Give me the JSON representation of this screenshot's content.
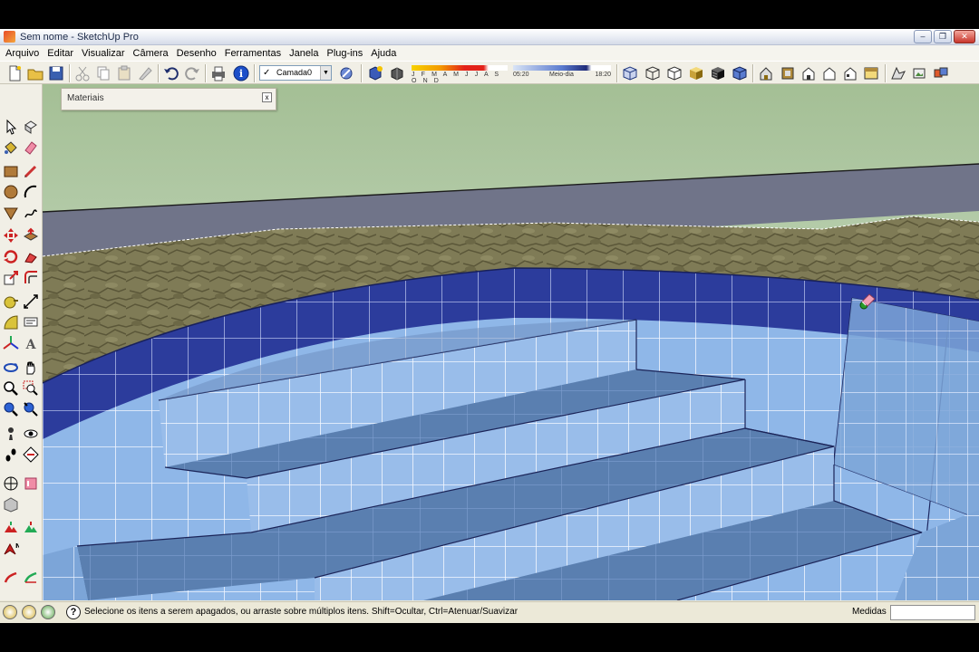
{
  "window": {
    "title": "Sem nome - SketchUp Pro",
    "minimize_glyph": "–",
    "maximize_glyph": "❐",
    "close_glyph": "✕"
  },
  "menu": [
    "Arquivo",
    "Editar",
    "Visualizar",
    "Câmera",
    "Desenho",
    "Ferramentas",
    "Janela",
    "Plug-ins",
    "Ajuda"
  ],
  "toolbar": {
    "layer_check": "✓",
    "layer_name": "Camada0",
    "layer_arrow": "▼",
    "shadow_months": "J F M A M J J A S O N D",
    "shadow_time_start": "05:20",
    "shadow_time_mid": "Meio-dia",
    "shadow_time_end": "18:20"
  },
  "materials_panel": {
    "title": "Materiais",
    "close_glyph": "x"
  },
  "status": {
    "help_glyph": "?",
    "message": "Selecione os itens a serem apagados, ou arraste sobre múltiplos itens. Shift=Ocultar, Ctrl=Atenuar/Suavizar",
    "measure_label": "Medidas",
    "measure_value": ""
  },
  "colors": {
    "sky_horizon": "#a9c29a",
    "pool_wall_top": "#2c3c9c",
    "pool_tile": "#8fb7e8",
    "step_tread": "#5a7fb0",
    "stone_edge": "#7f7b56"
  }
}
